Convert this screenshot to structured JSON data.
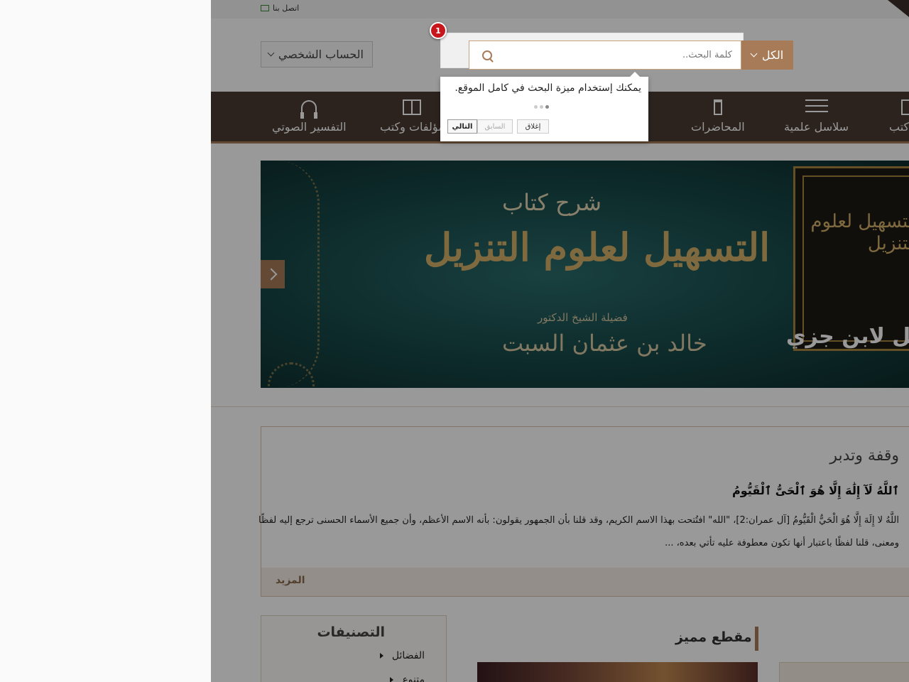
{
  "topbar": {
    "contact_label": "اتصل بنا",
    "icon": "envelope-icon"
  },
  "header": {
    "account_label": "الحساب الشخصي",
    "search": {
      "category": "الكل",
      "placeholder": "كلمة البحث.."
    }
  },
  "nav": {
    "items": [
      {
        "label": "التفسير الصوتي",
        "icon": "headphones-icon"
      },
      {
        "label": "مؤلفات وكتب",
        "icon": "book-icon"
      },
      {
        "label": "المحاضرات",
        "icon": "podium-icon"
      },
      {
        "label": "سلاسل علمية",
        "icon": "list-icon"
      },
      {
        "label": "كتب",
        "icon": "book-icon"
      }
    ]
  },
  "banner": {
    "subtitle": "شرح كتاب",
    "title": "التسهيل لعلوم التنزيل",
    "author_line1": "فضيلة الشيخ الدكتور",
    "author_line2": "خالد بن عثمان السبت",
    "book_title": "التسهيل لعلوم التنزيل",
    "caption": "التسهيل لابن جزي"
  },
  "verse_card": {
    "title": "وقفة وتدبر",
    "verse": "ٱللَّهُ لَآ إِلَٰهَ إِلَّا هُوَ ٱلْحَىُّ ٱلْقَيُّومُ",
    "text_line1": "اللَّهُ لا إِلَهَ إِلَّا هُوَ الْحَيُّ الْقَيُّومُ [آل عمران:2]، \"الله\" افتُتحت بهذا الاسم الكريم، وقد قلنا بأن الجمهور يقولون: بأنه الاسم الأعظم، وأن جميع الأسماء الحسنى ترجع إليه لفظًا",
    "text_line2": "ومعنى، قلنا لفظًا باعتبار أنها تكون معطوفة عليه تأتي بعده، ...",
    "more_label": "المزيد"
  },
  "featured": {
    "title": "مقطع مميز"
  },
  "categories": {
    "title": "التصنيفات",
    "items": [
      "الفضائل",
      "متنوع"
    ]
  },
  "guide": {
    "badge": "1",
    "text": "يمكنك إستخدام ميزة البحث في كامل الموقع.",
    "next_label": "التالي",
    "prev_label": "السابق",
    "close_label": "إغلاق",
    "steps_total": 3,
    "step_current": 1
  },
  "colors": {
    "accent": "#a77b57",
    "nav_bg": "#4a3b33",
    "badge": "#c8161d"
  }
}
